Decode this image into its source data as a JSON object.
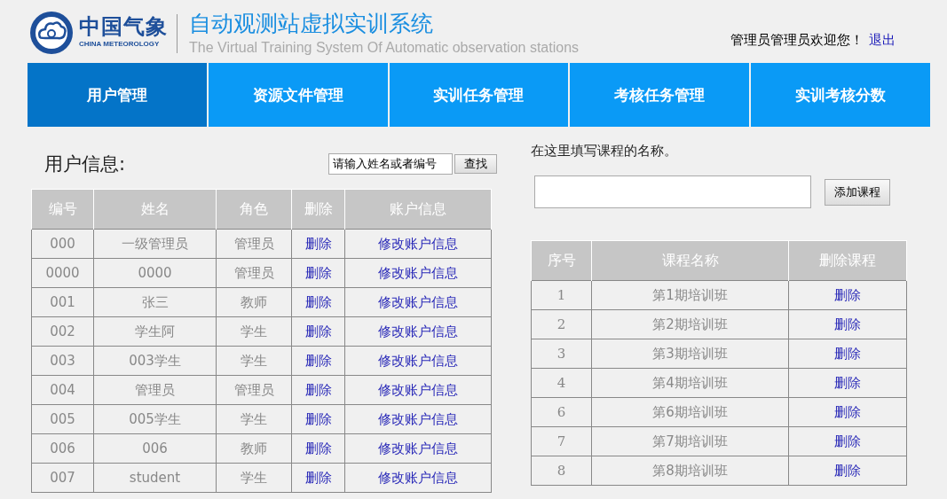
{
  "header": {
    "logo_cn": "中国气象",
    "logo_en": "CHINA METEOROLOGY",
    "title": "自动观测站虚拟实训系统",
    "subtitle": "The Virtual Training System Of Automatic observation stations",
    "welcome": "管理员管理员欢迎您！",
    "logout": "退出"
  },
  "nav": [
    {
      "label": "用户管理",
      "selected": true
    },
    {
      "label": "资源文件管理",
      "selected": false
    },
    {
      "label": "实训任务管理",
      "selected": false
    },
    {
      "label": "考核任务管理",
      "selected": false
    },
    {
      "label": "实训考核分数",
      "selected": false
    }
  ],
  "users": {
    "title": "用户信息:",
    "search": {
      "value": "请输入姓名或者编号",
      "button": "查找"
    },
    "columns": [
      "编号",
      "姓名",
      "角色",
      "删除",
      "账户信息"
    ],
    "rows": [
      [
        "000",
        "一级管理员",
        "管理员",
        "删除",
        "修改账户信息"
      ],
      [
        "0000",
        "0000",
        "管理员",
        "删除",
        "修改账户信息"
      ],
      [
        "001",
        "张三",
        "教师",
        "删除",
        "修改账户信息"
      ],
      [
        "002",
        "学生阿",
        "学生",
        "删除",
        "修改账户信息"
      ],
      [
        "003",
        "003学生",
        "学生",
        "删除",
        "修改账户信息"
      ],
      [
        "004",
        "管理员",
        "管理员",
        "删除",
        "修改账户信息"
      ],
      [
        "005",
        "005学生",
        "学生",
        "删除",
        "修改账户信息"
      ],
      [
        "006",
        "006",
        "教师",
        "删除",
        "修改账户信息"
      ],
      [
        "007",
        "student",
        "学生",
        "删除",
        "修改账户信息"
      ]
    ]
  },
  "courses": {
    "hint": "在这里填写课程的名称。",
    "button": "添加课程",
    "columns": [
      "序号",
      "课程名称",
      "删除课程"
    ],
    "rows": [
      [
        "1",
        "第1期培训班",
        "删除"
      ],
      [
        "2",
        "第2期培训班",
        "删除"
      ],
      [
        "3",
        "第3期培训班",
        "删除"
      ],
      [
        "4",
        "第4期培训班",
        "删除"
      ],
      [
        "6",
        "第6期培训班",
        "删除"
      ],
      [
        "7",
        "第7期培训班",
        "删除"
      ],
      [
        "8",
        "第8期培训班",
        "删除"
      ]
    ]
  }
}
